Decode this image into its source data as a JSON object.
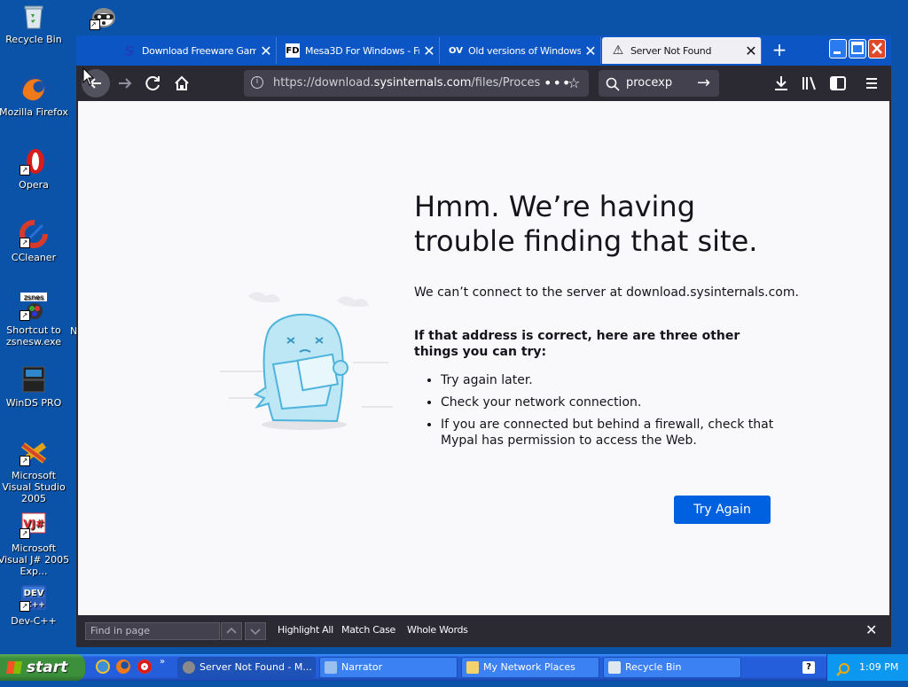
{
  "desktop": {
    "icons": [
      {
        "label": "Recycle Bin"
      },
      {
        "label": "Mozilla Firefox"
      },
      {
        "label": "Opera"
      },
      {
        "label": "CCleaner"
      },
      {
        "label": "Shortcut to zsnesw.exe"
      },
      {
        "label": "WinDS PRO"
      },
      {
        "label": "Microsoft Visual Studio 2005"
      },
      {
        "label": "Microsoft Visual J# 2005 Exp..."
      },
      {
        "label": "Dev-C++"
      }
    ],
    "partial_label": "N"
  },
  "browser": {
    "tabs": [
      {
        "title": "Download Freeware Gam",
        "icon": "S",
        "close": "✕"
      },
      {
        "title": "Mesa3D For Windows - Fr",
        "icon": "FD",
        "close": "✕"
      },
      {
        "title": "Old versions of Windows,",
        "icon": "OV",
        "close": "✕"
      },
      {
        "title": "Server Not Found",
        "icon": "⚠",
        "close": "✕"
      }
    ],
    "new_tab": "+",
    "url_prefix": "https://download.",
    "url_domain": "sysinternals.com",
    "url_suffix": "/files/Proces",
    "search_query": "procexp",
    "icons": {
      "back": "back-icon",
      "forward": "forward-icon",
      "reload": "reload-icon",
      "home": "home-icon",
      "info": "info-icon",
      "more": "more-icon",
      "bookmark": "star-icon",
      "search": "search-icon",
      "go": "arrow-right-icon",
      "download": "download-icon",
      "library": "library-icon",
      "sidebar": "sidebar-icon",
      "menu": "hamburger-icon"
    }
  },
  "error_page": {
    "title": "Hmm. We’re having trouble finding that site.",
    "description": "We can’t connect to the server at download.sysinternals.com.",
    "subhead": "If that address is correct, here are three other things you can try:",
    "tips": [
      "Try again later.",
      "Check your network connection.",
      "If you are connected but behind a firewall, check that Mypal has permission to access the Web."
    ],
    "button": "Try Again"
  },
  "find_bar": {
    "placeholder": "Find in page",
    "highlight_all": "Highlight All",
    "match_case": "Match Case",
    "whole_words": "Whole Words"
  },
  "taskbar": {
    "start": "start",
    "tasks": [
      {
        "label": "Server Not Found - M..."
      },
      {
        "label": "Narrator"
      },
      {
        "label": "My Network Places"
      },
      {
        "label": "Recycle Bin"
      }
    ],
    "clock": "1:09 PM"
  },
  "colors": {
    "desktop": "#0a53a8",
    "tabbar": "#0b56c4",
    "toolbar": "#2b2a33",
    "accent_button": "#0061e0",
    "page_bg": "#f9f9fb"
  }
}
